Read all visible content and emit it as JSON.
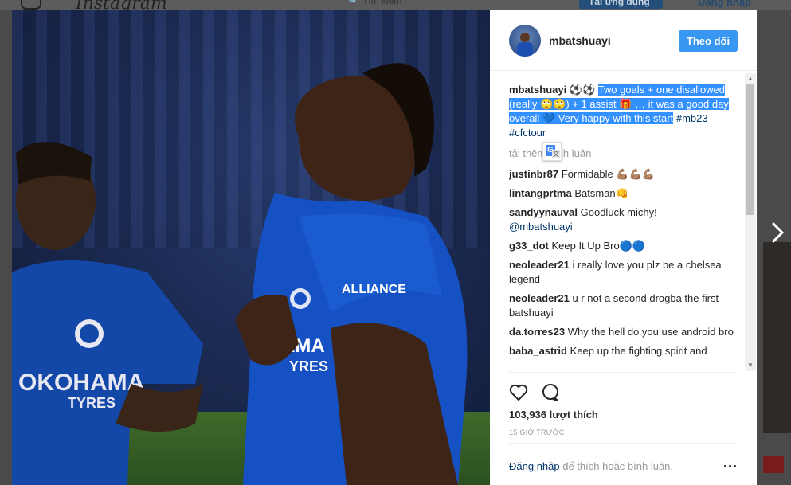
{
  "background_page": {
    "brand": "Instagram",
    "search_placeholder": "Tìm kiếm",
    "get_app_label": "Tải ứng dụng",
    "login_label": "Đăng nhập"
  },
  "post": {
    "username": "mbatshuayi",
    "follow_label": "Theo dõi",
    "caption": {
      "user": "mbatshuayi",
      "prefix": " ⚽⚽ ",
      "highlighted": "Two goals + one disallowed (really 🙄🙄) + 1 assist 🎁 … it was a good day overall 💙 Very happy with this start",
      "hashtags": "#mb23 #cfctour"
    },
    "load_more_label": "tải thêm bình luận",
    "comments": [
      {
        "user": "justinbr87",
        "text": "Formidable 💪🏽💪🏽💪🏽"
      },
      {
        "user": "lintangprtma",
        "text": "Batsman👊"
      },
      {
        "user": "sandyynauval",
        "text": "Goodluck michy! ",
        "mention": "@mbatshuayi"
      },
      {
        "user": "g33_dot",
        "text": "Keep It Up Bro🔵🔵"
      },
      {
        "user": "neoleader21",
        "text": "i really love you plz be a chelsea legend"
      },
      {
        "user": "neoleader21",
        "text": "u r not a second drogba the first batshuayi"
      },
      {
        "user": "da.torres23",
        "text": "Why the hell do you use android bro"
      },
      {
        "user": "baba_astrid",
        "text": "Keep up the fighting spirit and"
      }
    ],
    "likes": "103,936 lượt thích",
    "timestamp": "15 GIỜ TRƯỚC",
    "footer": {
      "login_link": "Đăng nhập",
      "rest": " để thích hoặc bình luận."
    }
  },
  "icons": {
    "like": "heart-icon",
    "comment": "speech-bubble-icon",
    "more": "ellipsis-icon",
    "next": "chevron-right-icon",
    "translate": "google-translate-icon"
  },
  "colors": {
    "follow_button": "#3897f0",
    "selection": "#3390ff",
    "link": "#003569",
    "muted": "#999999"
  }
}
